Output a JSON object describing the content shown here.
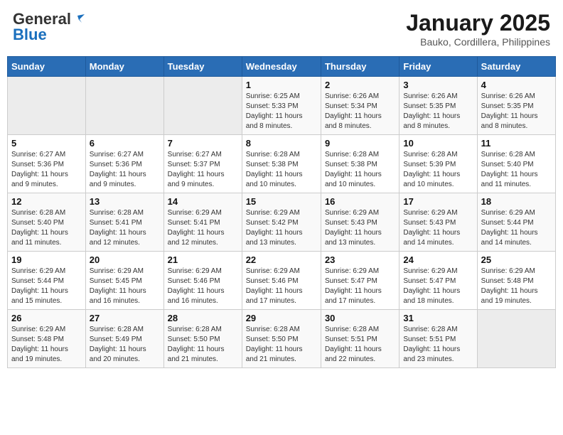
{
  "logo": {
    "general": "General",
    "blue": "Blue"
  },
  "title": "January 2025",
  "subtitle": "Bauko, Cordillera, Philippines",
  "weekdays": [
    "Sunday",
    "Monday",
    "Tuesday",
    "Wednesday",
    "Thursday",
    "Friday",
    "Saturday"
  ],
  "weeks": [
    [
      {
        "day": "",
        "info": ""
      },
      {
        "day": "",
        "info": ""
      },
      {
        "day": "",
        "info": ""
      },
      {
        "day": "1",
        "info": "Sunrise: 6:25 AM\nSunset: 5:33 PM\nDaylight: 11 hours\nand 8 minutes."
      },
      {
        "day": "2",
        "info": "Sunrise: 6:26 AM\nSunset: 5:34 PM\nDaylight: 11 hours\nand 8 minutes."
      },
      {
        "day": "3",
        "info": "Sunrise: 6:26 AM\nSunset: 5:35 PM\nDaylight: 11 hours\nand 8 minutes."
      },
      {
        "day": "4",
        "info": "Sunrise: 6:26 AM\nSunset: 5:35 PM\nDaylight: 11 hours\nand 8 minutes."
      }
    ],
    [
      {
        "day": "5",
        "info": "Sunrise: 6:27 AM\nSunset: 5:36 PM\nDaylight: 11 hours\nand 9 minutes."
      },
      {
        "day": "6",
        "info": "Sunrise: 6:27 AM\nSunset: 5:36 PM\nDaylight: 11 hours\nand 9 minutes."
      },
      {
        "day": "7",
        "info": "Sunrise: 6:27 AM\nSunset: 5:37 PM\nDaylight: 11 hours\nand 9 minutes."
      },
      {
        "day": "8",
        "info": "Sunrise: 6:28 AM\nSunset: 5:38 PM\nDaylight: 11 hours\nand 10 minutes."
      },
      {
        "day": "9",
        "info": "Sunrise: 6:28 AM\nSunset: 5:38 PM\nDaylight: 11 hours\nand 10 minutes."
      },
      {
        "day": "10",
        "info": "Sunrise: 6:28 AM\nSunset: 5:39 PM\nDaylight: 11 hours\nand 10 minutes."
      },
      {
        "day": "11",
        "info": "Sunrise: 6:28 AM\nSunset: 5:40 PM\nDaylight: 11 hours\nand 11 minutes."
      }
    ],
    [
      {
        "day": "12",
        "info": "Sunrise: 6:28 AM\nSunset: 5:40 PM\nDaylight: 11 hours\nand 11 minutes."
      },
      {
        "day": "13",
        "info": "Sunrise: 6:28 AM\nSunset: 5:41 PM\nDaylight: 11 hours\nand 12 minutes."
      },
      {
        "day": "14",
        "info": "Sunrise: 6:29 AM\nSunset: 5:41 PM\nDaylight: 11 hours\nand 12 minutes."
      },
      {
        "day": "15",
        "info": "Sunrise: 6:29 AM\nSunset: 5:42 PM\nDaylight: 11 hours\nand 13 minutes."
      },
      {
        "day": "16",
        "info": "Sunrise: 6:29 AM\nSunset: 5:43 PM\nDaylight: 11 hours\nand 13 minutes."
      },
      {
        "day": "17",
        "info": "Sunrise: 6:29 AM\nSunset: 5:43 PM\nDaylight: 11 hours\nand 14 minutes."
      },
      {
        "day": "18",
        "info": "Sunrise: 6:29 AM\nSunset: 5:44 PM\nDaylight: 11 hours\nand 14 minutes."
      }
    ],
    [
      {
        "day": "19",
        "info": "Sunrise: 6:29 AM\nSunset: 5:44 PM\nDaylight: 11 hours\nand 15 minutes."
      },
      {
        "day": "20",
        "info": "Sunrise: 6:29 AM\nSunset: 5:45 PM\nDaylight: 11 hours\nand 16 minutes."
      },
      {
        "day": "21",
        "info": "Sunrise: 6:29 AM\nSunset: 5:46 PM\nDaylight: 11 hours\nand 16 minutes."
      },
      {
        "day": "22",
        "info": "Sunrise: 6:29 AM\nSunset: 5:46 PM\nDaylight: 11 hours\nand 17 minutes."
      },
      {
        "day": "23",
        "info": "Sunrise: 6:29 AM\nSunset: 5:47 PM\nDaylight: 11 hours\nand 17 minutes."
      },
      {
        "day": "24",
        "info": "Sunrise: 6:29 AM\nSunset: 5:47 PM\nDaylight: 11 hours\nand 18 minutes."
      },
      {
        "day": "25",
        "info": "Sunrise: 6:29 AM\nSunset: 5:48 PM\nDaylight: 11 hours\nand 19 minutes."
      }
    ],
    [
      {
        "day": "26",
        "info": "Sunrise: 6:29 AM\nSunset: 5:48 PM\nDaylight: 11 hours\nand 19 minutes."
      },
      {
        "day": "27",
        "info": "Sunrise: 6:28 AM\nSunset: 5:49 PM\nDaylight: 11 hours\nand 20 minutes."
      },
      {
        "day": "28",
        "info": "Sunrise: 6:28 AM\nSunset: 5:50 PM\nDaylight: 11 hours\nand 21 minutes."
      },
      {
        "day": "29",
        "info": "Sunrise: 6:28 AM\nSunset: 5:50 PM\nDaylight: 11 hours\nand 21 minutes."
      },
      {
        "day": "30",
        "info": "Sunrise: 6:28 AM\nSunset: 5:51 PM\nDaylight: 11 hours\nand 22 minutes."
      },
      {
        "day": "31",
        "info": "Sunrise: 6:28 AM\nSunset: 5:51 PM\nDaylight: 11 hours\nand 23 minutes."
      },
      {
        "day": "",
        "info": ""
      }
    ]
  ]
}
